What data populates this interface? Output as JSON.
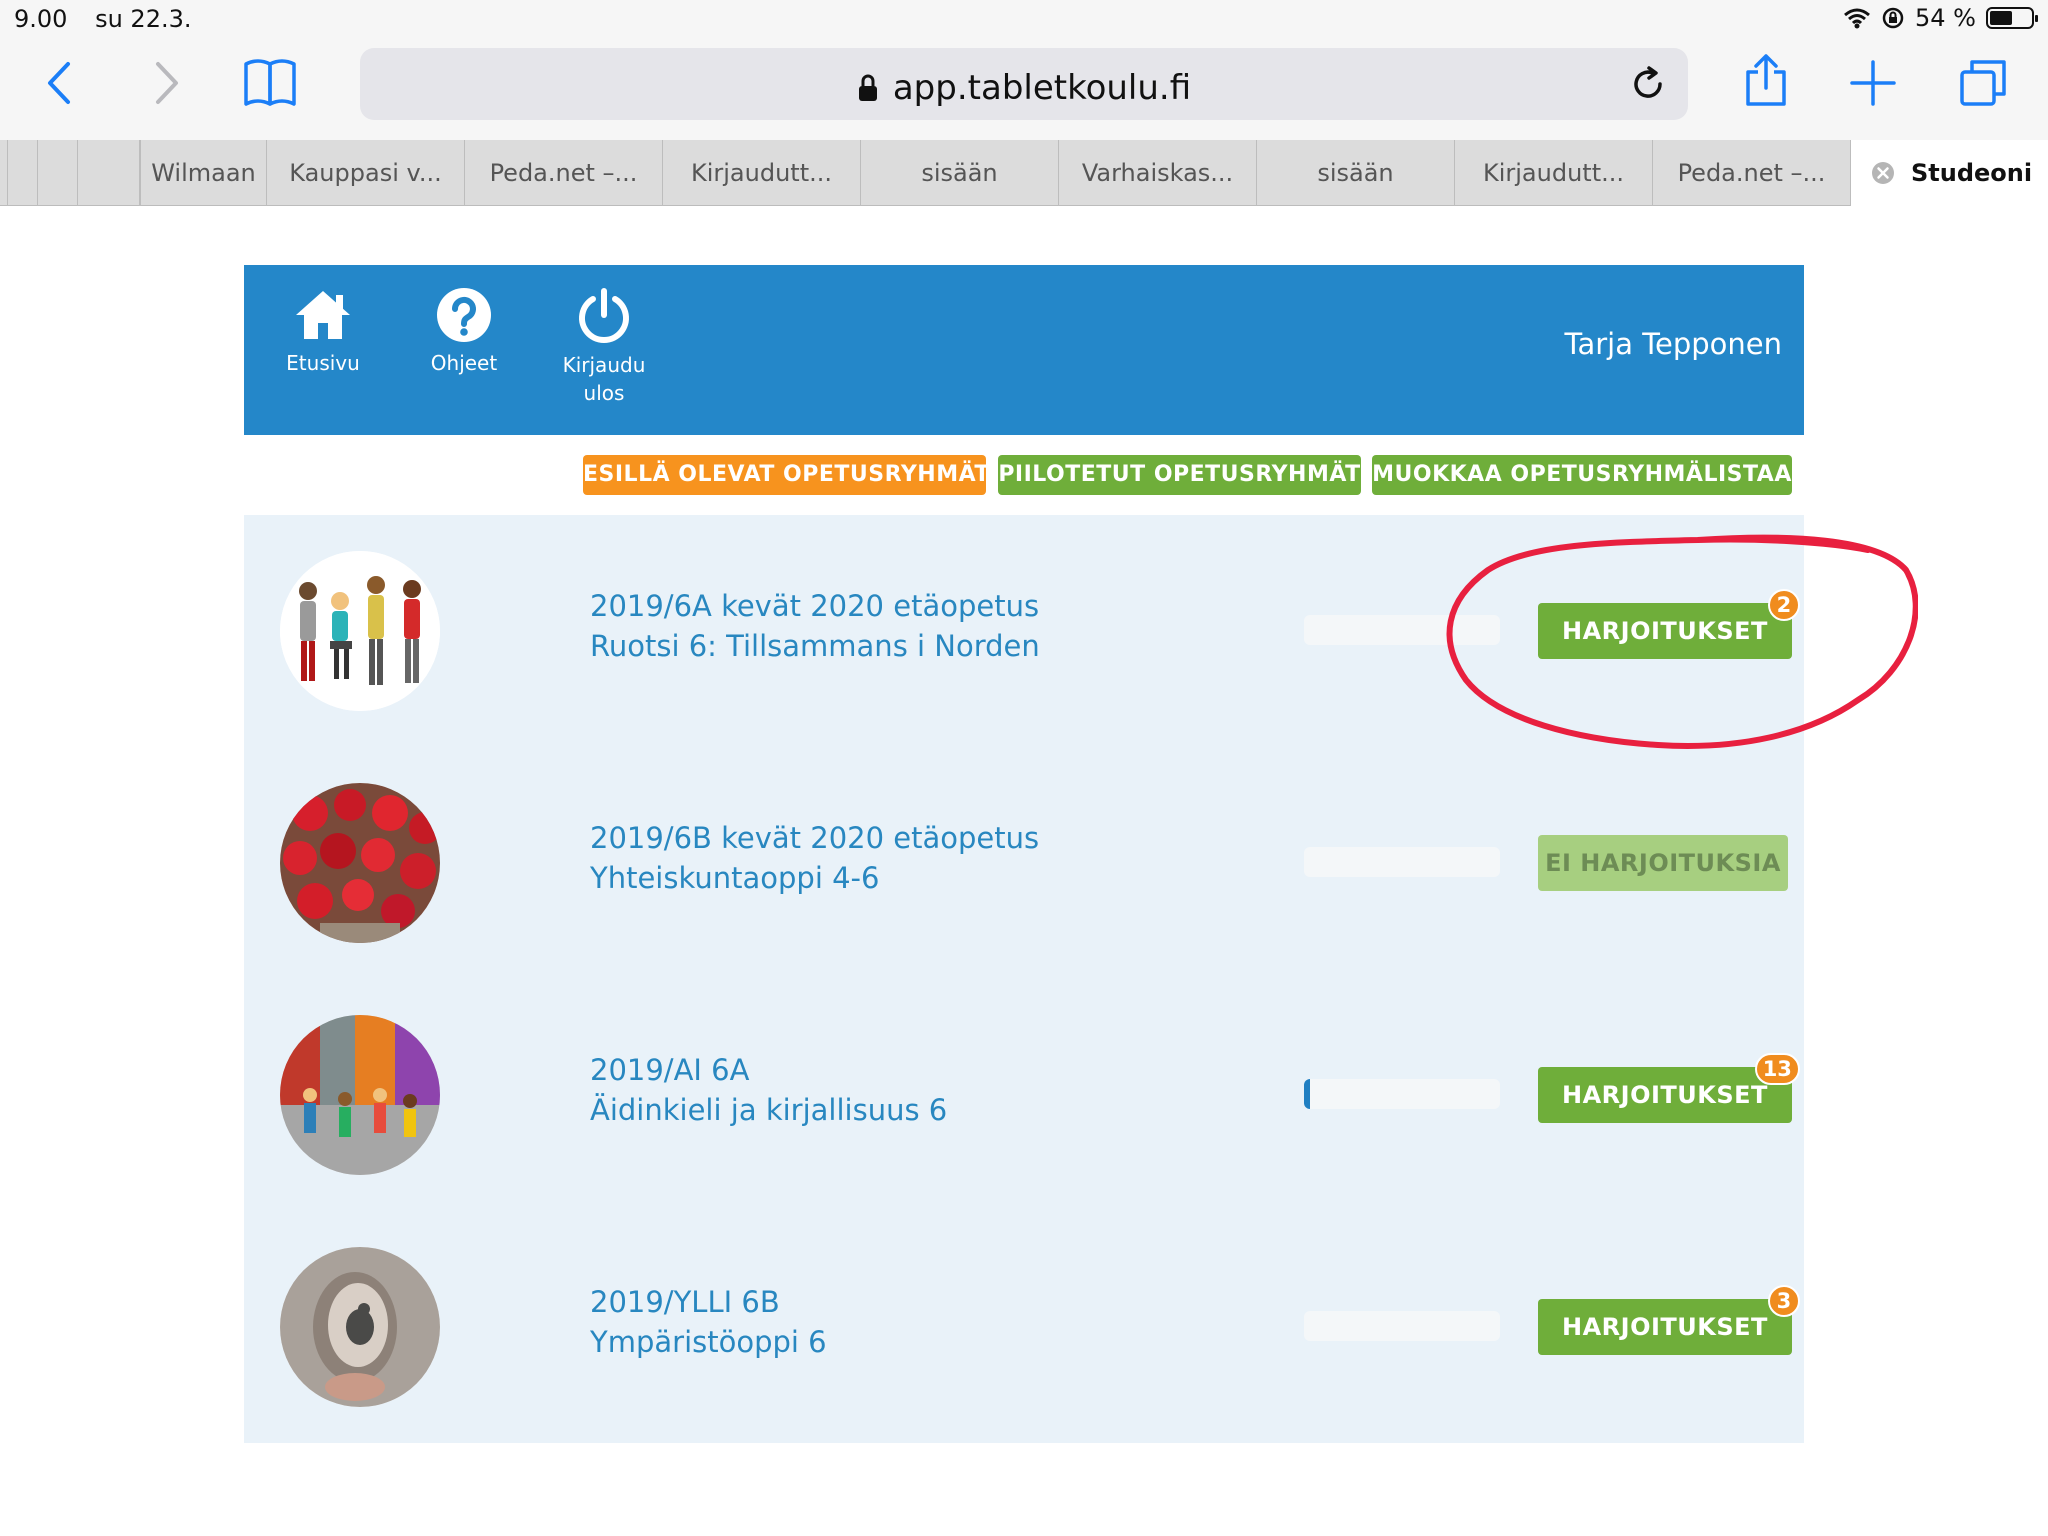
{
  "status_bar": {
    "time": "9.00",
    "date": "su 22.3.",
    "battery": "54 %",
    "battery_level": 0.54
  },
  "browser": {
    "url": "app.tabletkoulu.fi",
    "tabs": [
      {
        "label": "Wilmaan"
      },
      {
        "label": "Kauppasi v..."
      },
      {
        "label": "Peda.net –..."
      },
      {
        "label": "Kirjaudutt..."
      },
      {
        "label": "sisään"
      },
      {
        "label": "Varhaiskas..."
      },
      {
        "label": "sisään"
      },
      {
        "label": "Kirjaudutt..."
      },
      {
        "label": "Peda.net –..."
      },
      {
        "label": "Studeoni",
        "active": true
      }
    ]
  },
  "header": {
    "nav": [
      {
        "label": "Etusivu",
        "icon": "home-icon"
      },
      {
        "label": "Ohjeet",
        "icon": "help-icon"
      },
      {
        "label": "Kirjaudu ulos",
        "icon": "power-icon"
      }
    ],
    "user": "Tarja Tepponen"
  },
  "filters": {
    "visible": "ESILLÄ OLEVAT OPETUSRYHMÄT",
    "hidden": "PIILOTETUT OPETUSRYHMÄT",
    "edit": "MUOKKAA OPETUSRYHMÄLISTAA"
  },
  "groups": [
    {
      "name": "2019/6A kevät 2020 etäopetus",
      "course": "Ruotsi 6: Tillsammans i Norden",
      "progress": 0,
      "button": "HARJOITUKSET",
      "badge": "2"
    },
    {
      "name": "2019/6B kevät 2020 etäopetus",
      "course": "Yhteiskuntaoppi 4-6",
      "progress": 0,
      "button": "EI HARJOITUKSIA"
    },
    {
      "name": "2019/AI 6A",
      "course": "Äidinkieli ja kirjallisuus 6",
      "progress": 0.03,
      "button": "HARJOITUKSET",
      "badge": "13"
    },
    {
      "name": "2019/YLLI 6B",
      "course": "Ympäristöoppi 6",
      "progress": 0,
      "button": "HARJOITUKSET",
      "badge": "3"
    }
  ],
  "colors": {
    "header_blue": "#2487c9",
    "filter_orange": "#f7931e",
    "filter_green": "#6fae3a",
    "badge_orange": "#f08c1e",
    "annotation_red": "#e8203f"
  }
}
